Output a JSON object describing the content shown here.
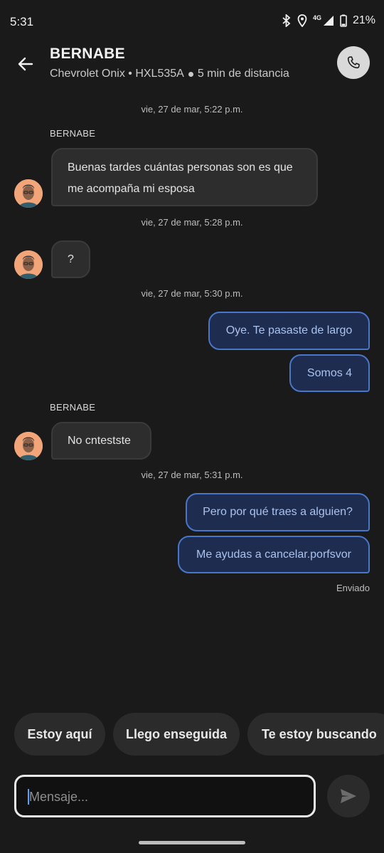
{
  "status_bar": {
    "time": "5:31",
    "network": "4G",
    "battery": "21%"
  },
  "header": {
    "title": "BERNABE",
    "vehicle": "Chevrolet Onix • HXL535A",
    "distance": "5 min de distancia"
  },
  "chat": {
    "timestamps": [
      "vie, 27 de mar, 5:22 p.m.",
      "vie, 27 de mar, 5:28 p.m.",
      "vie, 27 de mar, 5:30 p.m.",
      "vie, 27 de mar, 5:31 p.m."
    ],
    "sender_name": "BERNABE",
    "incoming": [
      {
        "lines": [
          "Buenas tardes cuántas personas son es que",
          "me acompaña mi esposa"
        ]
      },
      {
        "lines": [
          "?"
        ]
      },
      {
        "lines": [
          "No cntestste"
        ]
      }
    ],
    "outgoing": [
      "Oye. Te pasaste de largo",
      "Somos 4",
      "Pero por qué traes a alguien?",
      "Me ayudas a cancelar.porfsvor"
    ],
    "sent_status": "Enviado"
  },
  "quick_replies": [
    "Estoy aquí",
    "Llego enseguida",
    "Te estoy buscando"
  ],
  "composer": {
    "placeholder": "Mensaje..."
  },
  "colors": {
    "background": "#1a1a1a",
    "outgoing_bubble": "#1e2d4f",
    "outgoing_border": "#4a76c7",
    "incoming_bubble": "#2d2d2d"
  }
}
